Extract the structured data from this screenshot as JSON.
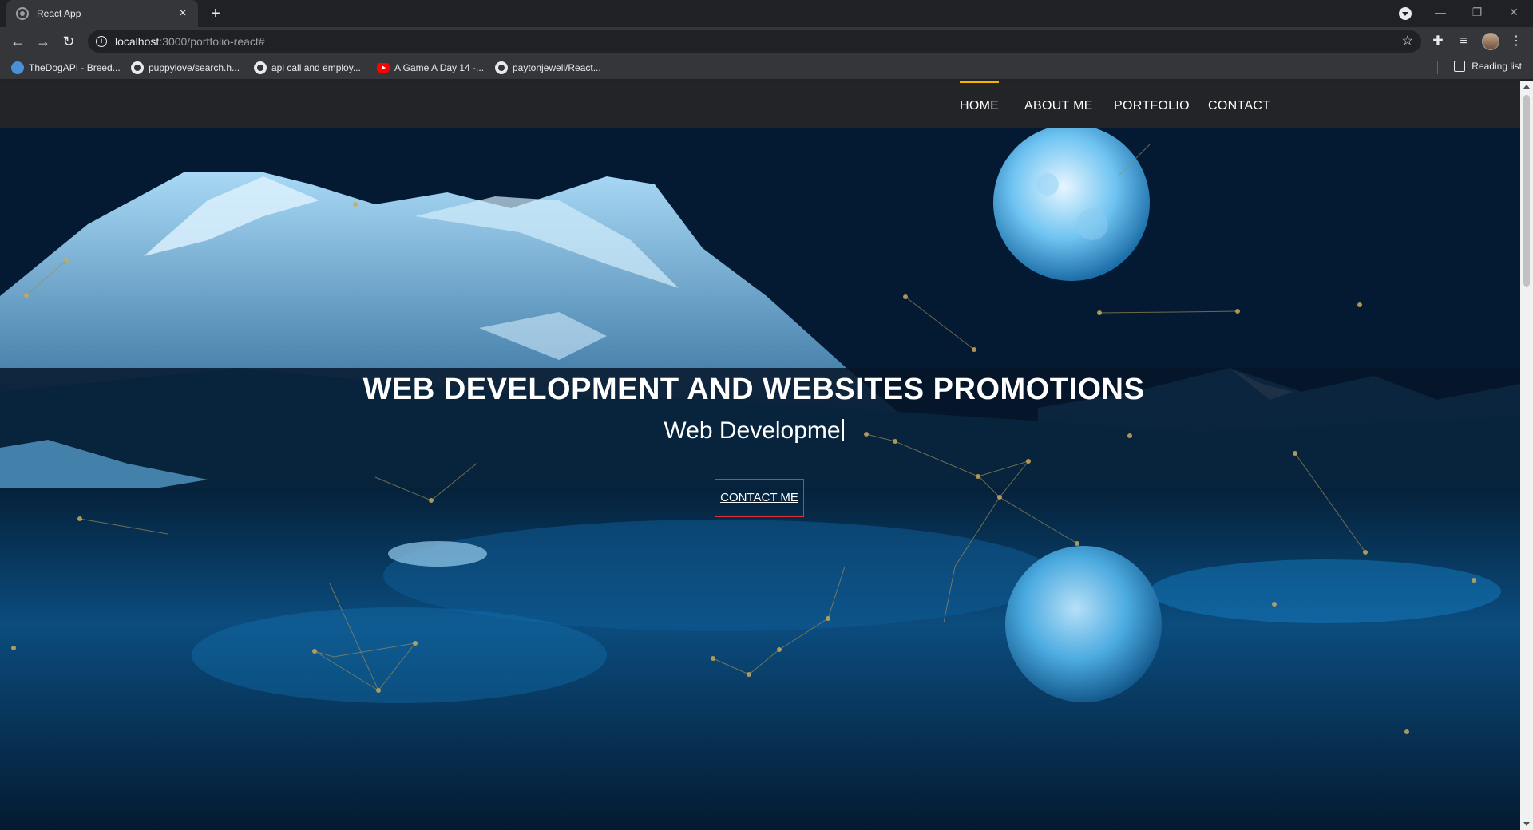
{
  "browser": {
    "tab_title": "React App",
    "tab_close": "×",
    "new_tab": "+",
    "url_host": "localhost",
    "url_path": ":3000/portfolio-react#",
    "window_controls": {
      "minimize": "—",
      "restore": "❐",
      "close": "✕"
    }
  },
  "bookmarks": [
    {
      "label": "TheDogAPI - Breed...",
      "icon": "dog-api-icon"
    },
    {
      "label": "puppylove/search.h...",
      "icon": "github-icon"
    },
    {
      "label": "api call and employ...",
      "icon": "github-icon"
    },
    {
      "label": "A Game A Day 14 -...",
      "icon": "youtube-icon"
    },
    {
      "label": "paytonjewell/React...",
      "icon": "github-icon"
    }
  ],
  "reading_list": "Reading list",
  "nav": {
    "items": [
      {
        "label": "HOME",
        "active": true
      },
      {
        "label": "ABOUT ME",
        "active": false
      },
      {
        "label": "PORTFOLIO",
        "active": false
      },
      {
        "label": "CONTACT",
        "active": false
      }
    ],
    "accent_color": "#f5b400"
  },
  "hero": {
    "title": "WEB DEVELOPMENT AND WEBSITES PROMOTIONS",
    "typed_text": "Web Developme",
    "cta_label": "CONTACT ME",
    "cta_border_color": "#e0303a"
  }
}
